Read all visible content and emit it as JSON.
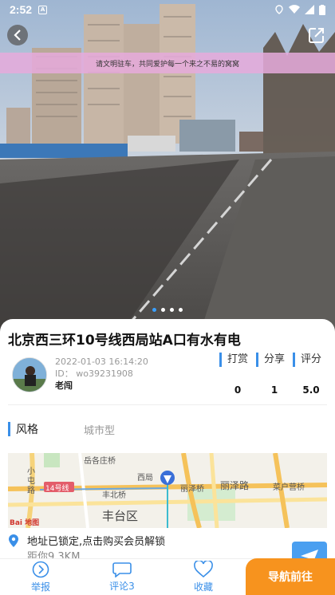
{
  "status_bar": {
    "time": "2:52",
    "notification": "A"
  },
  "banner": {
    "text": "请文明驻车，共同爱护每一个来之不易的窝窝"
  },
  "carousel": {
    "count": 4,
    "active_index": 0
  },
  "spot": {
    "title": "北京西三环10号线西局站A口有水有电",
    "date": "2022-01-03 16:14:20",
    "id_label": "ID：",
    "id_value": "wo39231908",
    "author": "老闯"
  },
  "stats": {
    "labels": [
      "打赏",
      "分享",
      "评分"
    ],
    "values": [
      "0",
      "1",
      "5.0"
    ]
  },
  "style": {
    "key": "风格",
    "value": "城市型"
  },
  "map": {
    "labels": {
      "yueguzhuang": "岳各庄桥",
      "xiaotunlu": "小屯路",
      "line14": "14号线",
      "fengbeiqiao": "丰北桥",
      "xiju": "西局",
      "lizeqiao": "丽泽桥",
      "lizelu": "丽泽路",
      "caihuyingqiao": "菜户营桥",
      "fengtaiqu": "丰台区",
      "logo": "Bai 地图"
    }
  },
  "address": {
    "line1": "地址已锁定,点击购买会员解锁",
    "line2": "距你9.3KM"
  },
  "bottom_nav": {
    "report": "举报",
    "comment": "评论3",
    "favorite": "收藏",
    "navigate": "导航前往"
  },
  "colors": {
    "accent": "#3a8fe8",
    "navigate": "#f7931e",
    "banner": "#e6aadc"
  }
}
